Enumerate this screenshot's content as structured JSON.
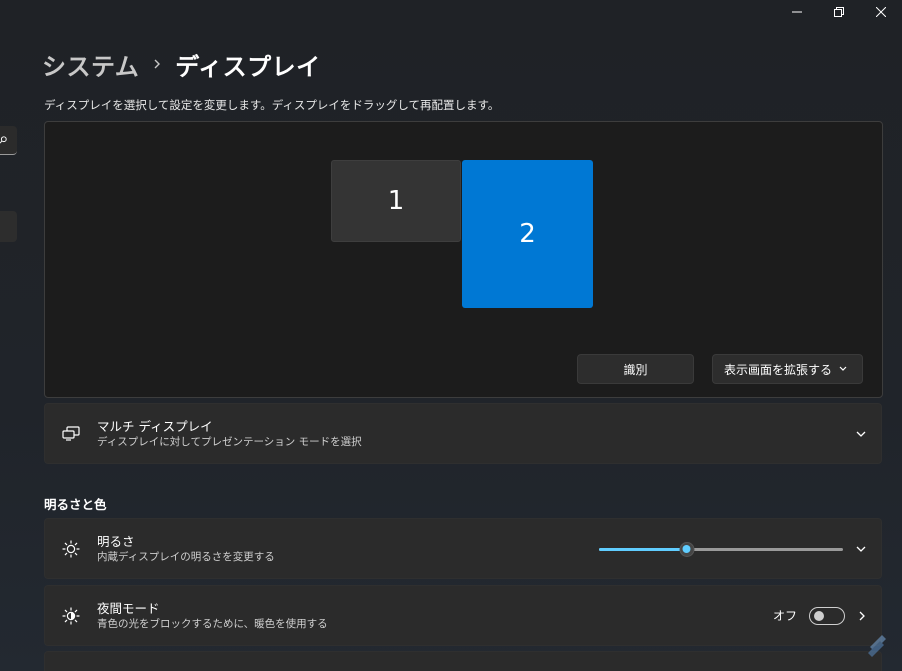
{
  "window": {
    "caption": {
      "minimize_icon": "minimize-icon",
      "restore_icon": "restore-icon",
      "close_icon": "close-icon"
    }
  },
  "nav": {
    "search_icon": "search-icon"
  },
  "breadcrumb": {
    "parent": "システム",
    "separator_icon": "chevron-right-icon",
    "current": "ディスプレイ"
  },
  "arrangement": {
    "instruction": "ディスプレイを選択して設定を変更します。ディスプレイをドラッグして再配置します。",
    "monitors": [
      {
        "label": "1",
        "selected": false
      },
      {
        "label": "2",
        "selected": true
      }
    ],
    "identify_label": "識別",
    "mode_select": {
      "value": "表示画面を拡張する",
      "icon": "chevron-down-icon"
    }
  },
  "multi_display": {
    "icon": "multi-display-icon",
    "title": "マルチ ディスプレイ",
    "subtitle": "ディスプレイに対してプレゼンテーション モードを選択",
    "expand_icon": "chevron-down-icon"
  },
  "brightness_section": {
    "title": "明るさと色",
    "brightness": {
      "icon": "sun-icon",
      "title": "明るさ",
      "subtitle": "内蔵ディスプレイの明るさを変更する",
      "level_percent": 36,
      "expand_icon": "chevron-down-icon"
    },
    "night_mode": {
      "icon": "night-light-icon",
      "title": "夜間モード",
      "subtitle": "青色の光をブロックするために、暖色を使用する",
      "toggle_label": "オフ",
      "toggle_on": false,
      "nav_icon": "chevron-right-icon"
    }
  },
  "colors": {
    "accent": "#0078d4",
    "slider_accent": "#60cdff",
    "card_bg": "#2b2b2b"
  }
}
